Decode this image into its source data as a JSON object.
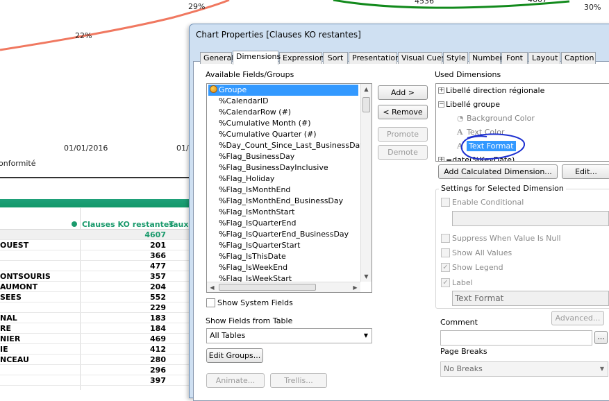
{
  "background_chart": {
    "pct_labels": [
      "29%",
      "22%",
      "30%"
    ],
    "value_labels": [
      "4536",
      "4607"
    ],
    "date_labels": [
      "01/01/2016",
      "01/"
    ],
    "legend_fragment": "onformité",
    "colors": {
      "salmon_series": "#f07860",
      "green_series": "#128a1c"
    }
  },
  "background_table": {
    "header": {
      "col_value": "Clauses KO restantes",
      "col_next": "Taux"
    },
    "total": "4607",
    "rows": [
      {
        "name": "OUEST",
        "value": "201"
      },
      {
        "name": "",
        "value": "366"
      },
      {
        "name": "",
        "value": "477"
      },
      {
        "name": "ONTSOURIS",
        "value": "357"
      },
      {
        "name": "AUMONT",
        "value": "204"
      },
      {
        "name": "SEES",
        "value": "552"
      },
      {
        "name": "",
        "value": "229"
      },
      {
        "name": "NAL",
        "value": "183"
      },
      {
        "name": "RE",
        "value": "184"
      },
      {
        "name": "NIER",
        "value": "469"
      },
      {
        "name": "IE",
        "value": "412"
      },
      {
        "name": "NCEAU",
        "value": "280"
      },
      {
        "name": "",
        "value": "296"
      },
      {
        "name": "",
        "value": "397"
      }
    ],
    "colors": {
      "accent": "#1a9a6c"
    }
  },
  "dialog": {
    "title": "Chart Properties [Clauses KO restantes]",
    "tabs": [
      "General",
      "Dimensions",
      "Expressions",
      "Sort",
      "Presentation",
      "Visual Cues",
      "Style",
      "Number",
      "Font",
      "Layout",
      "Caption"
    ],
    "active_tab": "Dimensions",
    "available": {
      "label": "Available Fields/Groups",
      "items": [
        "Groupe",
        "%CalendarID",
        "%CalendarRow (#)",
        "%Cumulative Month (#)",
        "%Cumulative Quarter (#)",
        "%Day_Count_Since_Last_BusinessDay",
        "%Flag_BusinessDay",
        "%Flag_BusinessDayInclusive",
        "%Flag_Holiday",
        "%Flag_IsMonthEnd",
        "%Flag_IsMonthEnd_BusinessDay",
        "%Flag_IsMonthStart",
        "%Flag_IsQuarterEnd",
        "%Flag_IsQuarterEnd_BusinessDay",
        "%Flag_IsQuarterStart",
        "%Flag_IsThisDate",
        "%Flag_IsWeekEnd",
        "%Flag_IsWeekStart"
      ],
      "selected_index": 0,
      "icon": "group-icon"
    },
    "buttons": {
      "add": "Add >",
      "remove": "< Remove",
      "promote": "Promote",
      "demote": "Demote",
      "add_calculated": "Add Calculated Dimension...",
      "edit": "Edit...",
      "edit_groups": "Edit Groups...",
      "animate": "Animate...",
      "trellis": "Trellis...",
      "advanced": "Advanced...",
      "ellipsis": "..."
    },
    "show_system_fields": "Show System Fields",
    "show_fields_from_table": {
      "label": "Show Fields from Table",
      "value": "All Tables"
    },
    "used": {
      "label": "Used Dimensions",
      "items": [
        {
          "label": "Libellé direction régionale",
          "expander": "+"
        },
        {
          "label": "Libellé groupe",
          "expander": "−"
        },
        {
          "label": "Background Color",
          "child": true,
          "icon": "palette-icon"
        },
        {
          "label": "Text Color",
          "child": true,
          "icon": "text-color-icon"
        },
        {
          "label": "Text Format",
          "child": true,
          "icon": "text-format-icon",
          "selected": true
        },
        {
          "label": "=date(%KeyDate)",
          "expander": "+"
        }
      ],
      "annotation_color": "#1c2fd0"
    },
    "settings": {
      "title": "Settings for Selected Dimension",
      "enable_conditional": "Enable Conditional",
      "suppress": "Suppress When Value Is Null",
      "show_all": "Show All Values",
      "show_legend": "Show Legend",
      "label_cb": "Label",
      "label_value": "Text Format",
      "comment": "Comment",
      "page_breaks": {
        "label": "Page Breaks",
        "value": "No Breaks"
      }
    },
    "colors": {
      "frame": "#cfe0f2",
      "selection": "#3399ff"
    }
  }
}
